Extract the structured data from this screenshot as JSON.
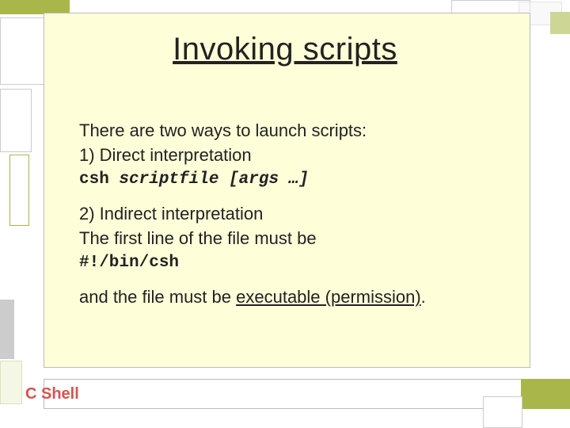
{
  "title": "Invoking scripts",
  "body": {
    "intro": "There are two ways to launch scripts:",
    "m1_label": "1) Direct interpretation",
    "m1_cmd_a": "csh",
    "m1_cmd_b": "scriptfile",
    "m1_cmd_c": "[args …]",
    "m2_label": "2) Indirect interpretation",
    "m2_desc": "The first line of the file must be",
    "m2_cmd": "#!/bin/csh",
    "m2_note_a": "and the file must be ",
    "m2_note_b": "executable (permission)",
    "m2_note_c": "."
  },
  "footer": "C Shell"
}
